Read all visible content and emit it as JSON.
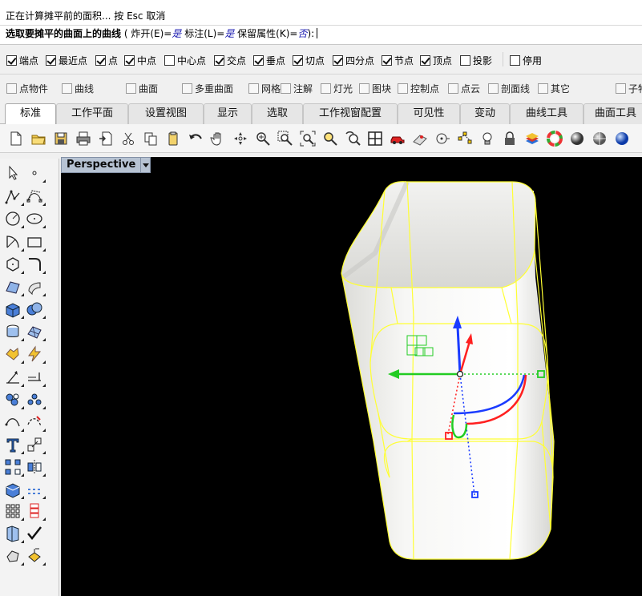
{
  "command": {
    "history": "正在计算摊平前的面积... 按 Esc 取消",
    "prompt_main": "选取要摊平的曲面上的曲线",
    "opt_open": "炸开(E)=",
    "opt_open_val": "是",
    "opt_annot": "标注(L)=",
    "opt_annot_val": "是",
    "opt_keep": "保留属性(K)=",
    "opt_keep_val": "否",
    "paren_open": "(",
    "paren_close": "):"
  },
  "osnap": {
    "items": [
      {
        "label": "端点",
        "checked": true
      },
      {
        "label": "最近点",
        "checked": true
      },
      {
        "label": "点",
        "checked": true
      },
      {
        "label": "中点",
        "checked": true
      },
      {
        "label": "中心点",
        "checked": false
      },
      {
        "label": "交点",
        "checked": true
      },
      {
        "label": "垂点",
        "checked": true
      },
      {
        "label": "切点",
        "checked": true
      },
      {
        "label": "四分点",
        "checked": true
      },
      {
        "label": "节点",
        "checked": true
      },
      {
        "label": "顶点",
        "checked": true
      },
      {
        "label": "投影",
        "checked": false
      },
      {
        "label": "停用",
        "checked": false
      }
    ]
  },
  "filters": {
    "items": [
      {
        "label": "点物件"
      },
      {
        "label": "曲线"
      },
      {
        "label": "曲面"
      },
      {
        "label": "多重曲面"
      },
      {
        "label": "网格"
      },
      {
        "label": "注解"
      },
      {
        "label": "灯光"
      },
      {
        "label": "图块"
      },
      {
        "label": "控制点"
      },
      {
        "label": "点云"
      },
      {
        "label": "剖面线"
      },
      {
        "label": "其它"
      },
      {
        "label": "子物"
      }
    ]
  },
  "tabs": [
    {
      "label": "标准",
      "active": true
    },
    {
      "label": "工作平面"
    },
    {
      "label": "设置视图"
    },
    {
      "label": "显示"
    },
    {
      "label": "选取"
    },
    {
      "label": "工作视窗配置"
    },
    {
      "label": "可见性"
    },
    {
      "label": "变动"
    },
    {
      "label": "曲线工具"
    },
    {
      "label": "曲面工具"
    }
  ],
  "viewport": {
    "name": "Perspective",
    "background": "#000000",
    "edge_color": "#ffff33",
    "axis_x": "#ff2020",
    "axis_y": "#22cc22",
    "axis_z": "#1a3bff"
  }
}
